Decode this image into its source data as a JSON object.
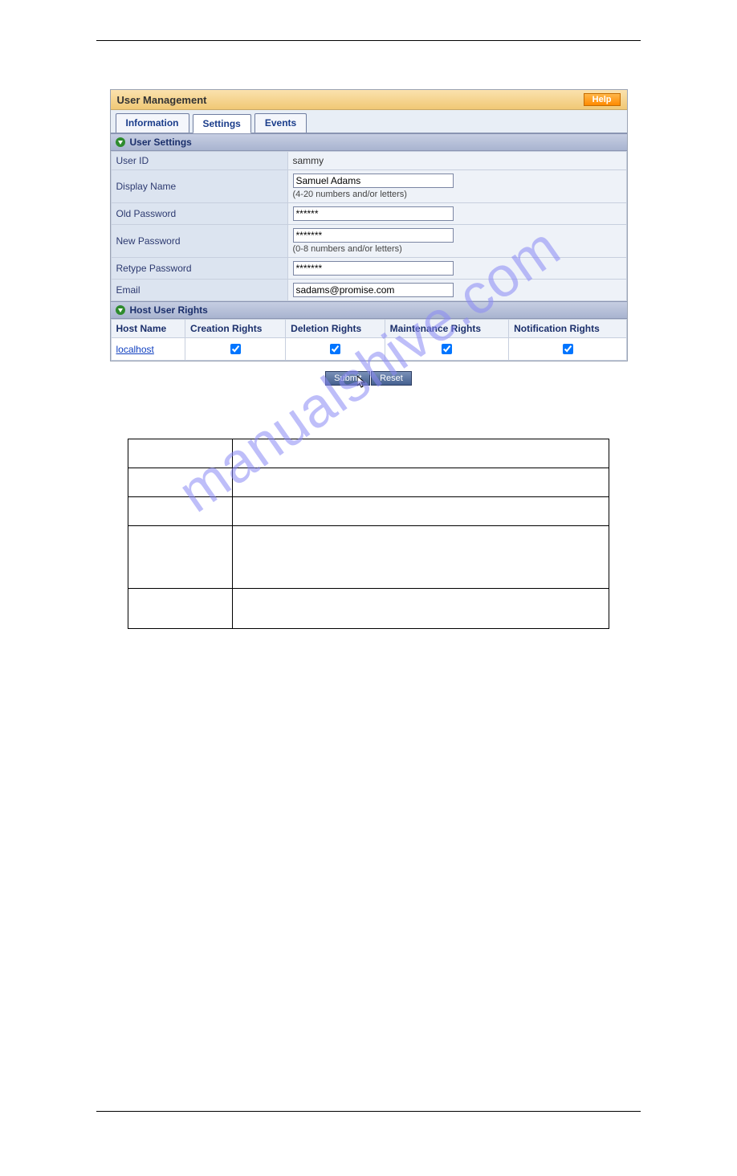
{
  "title": "User Management",
  "help": "Help",
  "tabs": {
    "info": "Information",
    "settings": "Settings",
    "events": "Events"
  },
  "sections": {
    "user_settings": "User Settings",
    "host_rights": "Host User Rights"
  },
  "fields": {
    "user_id": {
      "label": "User ID",
      "value": "sammy"
    },
    "display_name": {
      "label": "Display Name",
      "value": "Samuel Adams",
      "hint": "(4-20 numbers and/or letters)"
    },
    "old_pw": {
      "label": "Old Password",
      "value": "******"
    },
    "new_pw": {
      "label": "New Password",
      "value": "*******",
      "hint": "(0-8 numbers and/or letters)"
    },
    "retype_pw": {
      "label": "Retype Password",
      "value": "*******"
    },
    "email": {
      "label": "Email",
      "value": "sadams@promise.com"
    }
  },
  "rights": {
    "headers": {
      "host": "Host Name",
      "creation": "Creation Rights",
      "deletion": "Deletion Rights",
      "maintenance": "Maintenance Rights",
      "notification": "Notification Rights"
    },
    "row": {
      "host": "localhost"
    }
  },
  "buttons": {
    "submit": "Submit",
    "reset": "Reset"
  },
  "watermark": "manualshive.com"
}
